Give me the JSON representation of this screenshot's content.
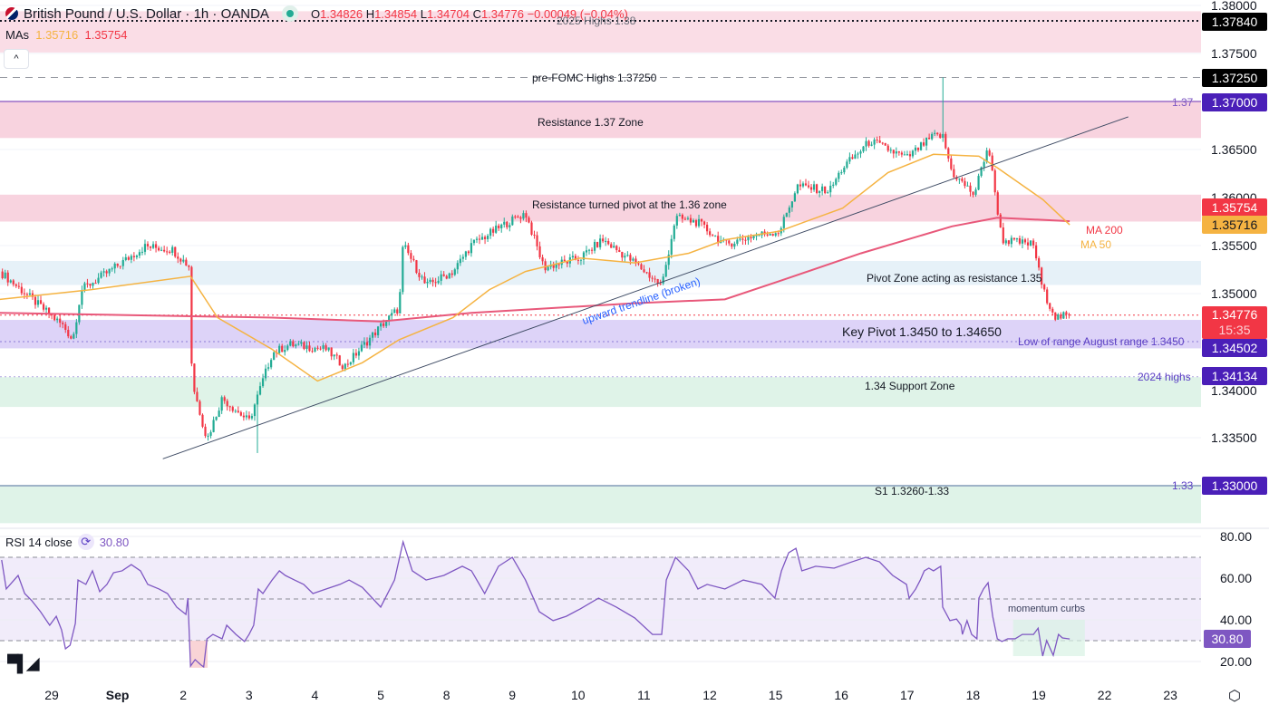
{
  "header": {
    "title": "British Pound / U.S. Dollar · 1h · OANDA",
    "o_label": "O",
    "o": "1.34826",
    "h_label": "H",
    "h": "1.34854",
    "l_label": "L",
    "l": "1.34704",
    "c_label": "C",
    "c": "1.34776",
    "change": "−0.00049 (−0.04%)"
  },
  "mas": {
    "label": "MAs",
    "ma50": "1.35716",
    "ma200": "1.35754"
  },
  "collapse_icon": "^",
  "colors": {
    "up": "#22ab94",
    "down": "#f23645",
    "ma50": "#f5b342",
    "ma200": "#e8587a",
    "purple": "#4a1fb8",
    "rsi": "#7e57c2"
  },
  "annotations": {
    "highs_2025": "2025 Highs 1.38",
    "pre_fomc": "pre-FOMC Highs 1.37250",
    "r137": "Resistance 1.37 Zone",
    "line137": "1.37",
    "r136": "Resistance turned pivot at the 1.36 zone",
    "pivot135": "Pivot Zone acting as resistance 1.35",
    "key_pivot": "Key Pivot 1.3450 to 1.34650",
    "aug_low": "Low of range August range 1.3450",
    "highs_2024": "2024 highs",
    "support134": "1.34 Support Zone",
    "line133": "1.33",
    "s1": "S1 1.3260-1.33",
    "trendline": "upward trendline (broken)",
    "ma200": "MA 200",
    "ma50": "MA 50",
    "momentum": "momentum curbs"
  },
  "price_axis": {
    "ticks": [
      "1.38000",
      "1.37500",
      "1.36500",
      "1.36000",
      "1.35500",
      "1.35000",
      "1.34000",
      "1.33500"
    ],
    "tags": {
      "t13784": "1.37840",
      "t13725": "1.37250",
      "t137": "1.37000",
      "ma200": "1.35754",
      "ma50": "1.35716",
      "last": "1.34776",
      "countdown": "15:35",
      "t13450": "1.34502",
      "t13413": "1.34134",
      "t133": "1.33000"
    }
  },
  "rsi": {
    "label": "RSI 14 close",
    "value": "30.80",
    "ticks": [
      "80.00",
      "60.00",
      "40.00",
      "20.00"
    ]
  },
  "time_axis": [
    "29",
    "Sep",
    "2",
    "3",
    "4",
    "5",
    "8",
    "9",
    "10",
    "11",
    "12",
    "15",
    "16",
    "17",
    "18",
    "19",
    "22",
    "23"
  ],
  "chart_data": {
    "type": "candlestick",
    "symbol": "GBPUSD",
    "interval": "1h",
    "x_unit": "trading days since Aug 29",
    "ylim": [
      1.3255,
      1.3805
    ],
    "close_path": [
      [
        -0.79,
        1.3523
      ],
      [
        0.18,
        1.3466
      ],
      [
        0.32,
        1.3452
      ],
      [
        0.45,
        1.3504
      ],
      [
        0.87,
        1.3523
      ],
      [
        1.42,
        1.3549
      ],
      [
        1.83,
        1.3546
      ],
      [
        2.11,
        1.3527
      ],
      [
        2.13,
        1.3409
      ],
      [
        2.36,
        1.3348
      ],
      [
        2.59,
        1.3391
      ],
      [
        3.0,
        1.3367
      ],
      [
        3.35,
        1.3438
      ],
      [
        3.62,
        1.3447
      ],
      [
        4.17,
        1.3442
      ],
      [
        4.45,
        1.3424
      ],
      [
        5.0,
        1.3466
      ],
      [
        5.28,
        1.3485
      ],
      [
        5.34,
        1.3551
      ],
      [
        5.69,
        1.3508
      ],
      [
        6.1,
        1.3523
      ],
      [
        6.38,
        1.3551
      ],
      [
        6.93,
        1.3574
      ],
      [
        7.2,
        1.3584
      ],
      [
        7.48,
        1.3527
      ],
      [
        8.03,
        1.3537
      ],
      [
        8.37,
        1.3556
      ],
      [
        8.86,
        1.3532
      ],
      [
        9.27,
        1.3508
      ],
      [
        9.48,
        1.3579
      ],
      [
        9.82,
        1.3574
      ],
      [
        10.23,
        1.3551
      ],
      [
        10.65,
        1.356
      ],
      [
        11.06,
        1.3565
      ],
      [
        11.33,
        1.3612
      ],
      [
        11.82,
        1.3607
      ],
      [
        12.02,
        1.3631
      ],
      [
        12.44,
        1.3659
      ],
      [
        12.99,
        1.3641
      ],
      [
        13.4,
        1.3664
      ],
      [
        13.54,
        1.3664
      ],
      [
        13.68,
        1.3626
      ],
      [
        14.02,
        1.3603
      ],
      [
        14.23,
        1.3655
      ],
      [
        14.37,
        1.3589
      ],
      [
        14.44,
        1.3556
      ],
      [
        14.92,
        1.3551
      ],
      [
        15.06,
        1.3504
      ],
      [
        15.26,
        1.3475
      ],
      [
        15.47,
        1.34776
      ]
    ],
    "wicks": [
      {
        "t": 13.54,
        "high": 1.3725
      },
      {
        "t": 3.11,
        "low": 1.3334
      }
    ],
    "ma50": [
      [
        -0.79,
        1.3494
      ],
      [
        0.59,
        1.3504
      ],
      [
        2.11,
        1.3518
      ],
      [
        2.52,
        1.3475
      ],
      [
        3.35,
        1.3442
      ],
      [
        4.04,
        1.3409
      ],
      [
        4.72,
        1.3428
      ],
      [
        5.28,
        1.3452
      ],
      [
        6.1,
        1.3475
      ],
      [
        6.65,
        1.3504
      ],
      [
        7.2,
        1.3523
      ],
      [
        8.03,
        1.3537
      ],
      [
        8.86,
        1.3532
      ],
      [
        9.68,
        1.3542
      ],
      [
        10.23,
        1.3556
      ],
      [
        11.06,
        1.3565
      ],
      [
        12.02,
        1.3589
      ],
      [
        12.71,
        1.3626
      ],
      [
        13.4,
        1.3645
      ],
      [
        14.09,
        1.3643
      ],
      [
        14.37,
        1.3631
      ],
      [
        15.06,
        1.3598
      ],
      [
        15.47,
        1.35716
      ]
    ],
    "ma200": [
      [
        -0.79,
        1.348
      ],
      [
        3.35,
        1.3475
      ],
      [
        5.0,
        1.3471
      ],
      [
        6.38,
        1.348
      ],
      [
        8.86,
        1.349
      ],
      [
        10.23,
        1.3494
      ],
      [
        11.06,
        1.3513
      ],
      [
        12.3,
        1.3542
      ],
      [
        13.68,
        1.357
      ],
      [
        14.37,
        1.3579
      ],
      [
        15.47,
        1.35754
      ]
    ],
    "trendline": [
      [
        1.69,
        1.3328
      ],
      [
        16.36,
        1.3684
      ]
    ],
    "zones": [
      {
        "name": "highs-2025-zone",
        "from": 1.3751,
        "to": 1.3794,
        "color": "#fadde6"
      },
      {
        "name": "resistance-137-zone",
        "from": 1.3662,
        "to": 1.37,
        "color": "#f8d3df"
      },
      {
        "name": "resistance-136-zone",
        "from": 1.3575,
        "to": 1.3603,
        "color": "#f8d3df"
      },
      {
        "name": "pivot-135-zone",
        "from": 1.3509,
        "to": 1.3534,
        "color": "#e6f1f8"
      },
      {
        "name": "key-pivot-zone",
        "from": 1.3443,
        "to": 1.34726,
        "color": "#ddd3f8"
      },
      {
        "name": "support-134-zone",
        "from": 1.3382,
        "to": 1.3413,
        "color": "#dff3e8"
      },
      {
        "name": "s1-zone",
        "from": 1.3261,
        "to": 1.33,
        "color": "#dff3e8"
      }
    ],
    "levels": [
      {
        "name": "highs-2025-line",
        "price": 1.3784,
        "style": "dotted",
        "color": "#131722"
      },
      {
        "name": "pre-fomc-line",
        "price": 1.3725,
        "style": "dashed",
        "color": "#9598a1"
      },
      {
        "name": "line-137",
        "price": 1.37,
        "style": "solid",
        "color": "#b38bd1"
      },
      {
        "name": "aug-low-line",
        "price": 1.345,
        "style": "dotted",
        "color": "#8c7bd6"
      },
      {
        "name": "highs-2024-line",
        "price": 1.34134,
        "style": "dotted",
        "color": "#b0a6e0"
      },
      {
        "name": "line-133",
        "price": 1.33,
        "style": "solid",
        "color": "#9fb3c8"
      },
      {
        "name": "last-price-line",
        "price": 1.34776,
        "style": "dotted",
        "color": "#f23645"
      }
    ],
    "rsi_ylim": [
      20,
      80
    ],
    "rsi_band": [
      30,
      70
    ],
    "rsi_series": [
      [
        -0.76,
        68.7
      ],
      [
        -0.69,
        54.8
      ],
      [
        -0.51,
        61.3
      ],
      [
        -0.41,
        52.6
      ],
      [
        -0.3,
        49.1
      ],
      [
        -0.17,
        43.9
      ],
      [
        -0.03,
        37.4
      ],
      [
        0.07,
        41.7
      ],
      [
        0.15,
        35.2
      ],
      [
        0.21,
        26.1
      ],
      [
        0.28,
        27.8
      ],
      [
        0.36,
        38.3
      ],
      [
        0.4,
        59.1
      ],
      [
        0.52,
        57.0
      ],
      [
        0.62,
        63.5
      ],
      [
        0.73,
        53.5
      ],
      [
        0.84,
        57.0
      ],
      [
        0.94,
        62.6
      ],
      [
        1.07,
        63.5
      ],
      [
        1.21,
        66.5
      ],
      [
        1.35,
        63.5
      ],
      [
        1.46,
        57.0
      ],
      [
        1.63,
        54.8
      ],
      [
        1.76,
        52.6
      ],
      [
        1.9,
        46.1
      ],
      [
        2.04,
        42.6
      ],
      [
        2.07,
        50.4
      ],
      [
        2.11,
        17.8
      ],
      [
        2.18,
        20.9
      ],
      [
        2.27,
        18.3
      ],
      [
        2.31,
        17.4
      ],
      [
        2.36,
        30.9
      ],
      [
        2.45,
        33.0
      ],
      [
        2.59,
        30.9
      ],
      [
        2.66,
        37.4
      ],
      [
        2.8,
        33.0
      ],
      [
        2.93,
        29.6
      ],
      [
        3.0,
        33.0
      ],
      [
        3.07,
        37.4
      ],
      [
        3.14,
        54.8
      ],
      [
        3.21,
        52.6
      ],
      [
        3.35,
        59.1
      ],
      [
        3.46,
        63.5
      ],
      [
        3.55,
        61.3
      ],
      [
        3.69,
        59.1
      ],
      [
        3.83,
        57.0
      ],
      [
        3.97,
        52.6
      ],
      [
        4.17,
        54.8
      ],
      [
        4.38,
        57.0
      ],
      [
        4.52,
        59.1
      ],
      [
        4.72,
        55.6
      ],
      [
        5.0,
        46.1
      ],
      [
        5.21,
        59.1
      ],
      [
        5.34,
        77.4
      ],
      [
        5.48,
        63.5
      ],
      [
        5.69,
        59.1
      ],
      [
        5.96,
        61.3
      ],
      [
        6.24,
        65.7
      ],
      [
        6.38,
        63.5
      ],
      [
        6.58,
        52.6
      ],
      [
        6.79,
        65.7
      ],
      [
        7.0,
        70.0
      ],
      [
        7.2,
        59.1
      ],
      [
        7.41,
        43.9
      ],
      [
        7.62,
        39.6
      ],
      [
        7.82,
        41.7
      ],
      [
        8.03,
        45.2
      ],
      [
        8.31,
        50.4
      ],
      [
        8.58,
        46.1
      ],
      [
        8.86,
        40.9
      ],
      [
        9.13,
        33.0
      ],
      [
        9.27,
        33.0
      ],
      [
        9.34,
        59.1
      ],
      [
        9.48,
        70.0
      ],
      [
        9.68,
        63.5
      ],
      [
        9.82,
        54.8
      ],
      [
        9.96,
        57.0
      ],
      [
        10.23,
        54.8
      ],
      [
        10.51,
        59.1
      ],
      [
        10.79,
        57.0
      ],
      [
        10.99,
        50.4
      ],
      [
        11.09,
        63.5
      ],
      [
        11.2,
        72.2
      ],
      [
        11.31,
        74.3
      ],
      [
        11.4,
        63.5
      ],
      [
        11.61,
        65.7
      ],
      [
        11.89,
        64.8
      ],
      [
        12.16,
        67.8
      ],
      [
        12.37,
        70.0
      ],
      [
        12.58,
        67.8
      ],
      [
        12.78,
        61.3
      ],
      [
        12.99,
        57.0
      ],
      [
        13.03,
        50.4
      ],
      [
        13.13,
        54.8
      ],
      [
        13.2,
        59.1
      ],
      [
        13.26,
        63.5
      ],
      [
        13.33,
        64.8
      ],
      [
        13.4,
        63.5
      ],
      [
        13.51,
        65.7
      ],
      [
        13.54,
        46.1
      ],
      [
        13.65,
        39.6
      ],
      [
        13.75,
        40.4
      ],
      [
        13.82,
        37.4
      ],
      [
        13.84,
        33.0
      ],
      [
        13.91,
        39.6
      ],
      [
        13.98,
        33.0
      ],
      [
        14.06,
        30.9
      ],
      [
        14.09,
        50.4
      ],
      [
        14.16,
        54.8
      ],
      [
        14.23,
        57.8
      ],
      [
        14.3,
        41.7
      ],
      [
        14.37,
        30.9
      ],
      [
        14.44,
        29.6
      ],
      [
        14.53,
        30.9
      ],
      [
        14.64,
        30.9
      ],
      [
        14.75,
        33.0
      ],
      [
        14.92,
        33.0
      ],
      [
        14.99,
        36.0
      ],
      [
        15.06,
        22.6
      ],
      [
        15.12,
        30.0
      ],
      [
        15.22,
        23.0
      ],
      [
        15.3,
        33.0
      ],
      [
        15.36,
        31.3
      ],
      [
        15.47,
        30.8
      ]
    ],
    "momentum_box": {
      "t_from": 14.61,
      "t_to": 15.7,
      "from": 22.6,
      "to": 40
    }
  }
}
